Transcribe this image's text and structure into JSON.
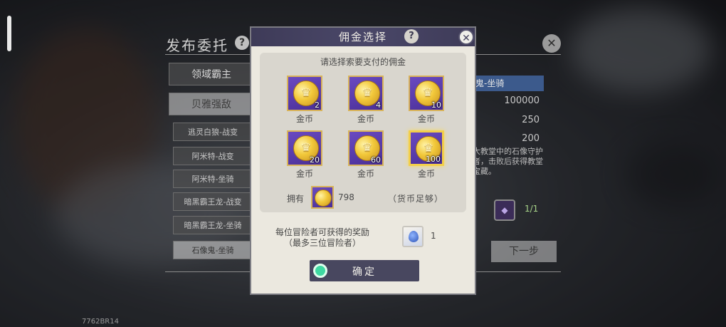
{
  "background": {
    "title": "发布委托",
    "help_icon": "?",
    "close_icon": "✕",
    "tabs": [
      "领域霸主",
      "贝雅强敌"
    ],
    "list_items": [
      "逃灵白狼-战变",
      "阿米特-战变",
      "阿米特-坐骑",
      "暗黑霸王龙-战变",
      "暗黑霸王龙-坐骑",
      "石像鬼-坐骑"
    ],
    "detail": {
      "selected_name": "鬼-坐骑",
      "values": [
        "100000",
        "250",
        "200"
      ],
      "description": "大教堂中的石像守护者，击败后获得教堂宝藏。",
      "progress": "1/1"
    },
    "next_button": "下一步",
    "bottom_code": "7762BR14"
  },
  "modal": {
    "title": "佣金选择",
    "help_label": "?",
    "close_label": "✕",
    "prompt": "请选择索要支付的佣金",
    "coin_symbol": "♛",
    "coins": [
      {
        "count": "2",
        "label": "金币"
      },
      {
        "count": "4",
        "label": "金币"
      },
      {
        "count": "10",
        "label": "金币"
      },
      {
        "count": "20",
        "label": "金币"
      },
      {
        "count": "60",
        "label": "金币"
      },
      {
        "count": "100",
        "label": "金币"
      }
    ],
    "selected_index": 5,
    "own_label": "拥有",
    "own_count": "798",
    "currency_status": "（货币足够）",
    "reward_line1": "每位冒险者可获得的奖励",
    "reward_line2": "（最多三位冒险者）",
    "reward_count": "1",
    "confirm_label": "确定"
  }
}
